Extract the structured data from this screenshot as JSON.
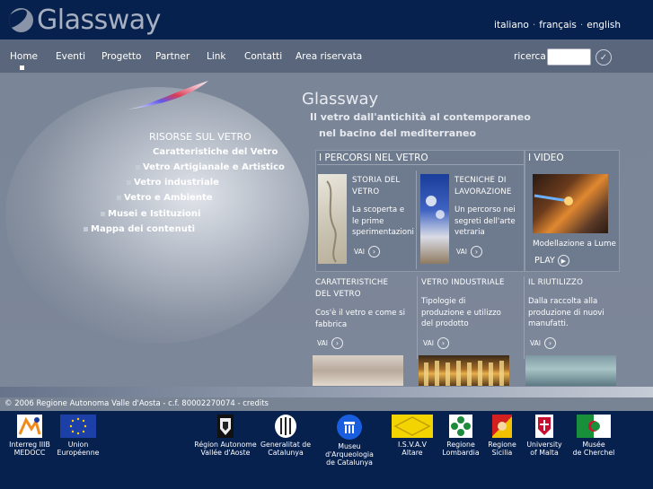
{
  "header": {
    "logo_text": "Glassway",
    "languages": [
      "italiano",
      "français",
      "english"
    ],
    "language_separator": "·"
  },
  "nav": {
    "items": [
      "Home",
      "Eventi",
      "Progetto",
      "Partner",
      "Link",
      "Contatti",
      "Area riservata"
    ],
    "search_label": "ricerca",
    "search_value": ""
  },
  "resources": {
    "title": "RISORSE SUL VETRO",
    "items": [
      "Caratteristiche del Vetro",
      "Vetro Artigianale e Artistico",
      "Vetro industriale",
      "Vetro e Ambiente",
      "Musei e Istituzioni",
      "Mappa dei contenuti"
    ]
  },
  "intro": {
    "title": "Glassway",
    "tagline_line1": "Il vetro dall'antichità al contemporaneo",
    "tagline_line2": "nel bacino del mediterraneo"
  },
  "percorsi": {
    "title": "I PERCORSI NEL VETRO",
    "cards": [
      {
        "title1": "STORIA DEL",
        "title2": "VETRO",
        "text": [
          "La scoperta e",
          "le prime",
          "sperimentazioni"
        ],
        "link": "VAI"
      },
      {
        "title1": "TECNICHE DI",
        "title2": "LAVORAZIONE",
        "text": [
          "Un percorso nei",
          "segreti dell'arte",
          "vetraria"
        ],
        "link": "VAI"
      }
    ]
  },
  "video": {
    "title": "I VIDEO",
    "caption": "Modellazione a Lume",
    "play_label": "PLAY"
  },
  "bottom_cards": [
    {
      "title1": "CARATTERISTICHE",
      "title2": "DEL VETRO",
      "text": [
        "Cos'è il vetro e come si",
        "fabbrica"
      ],
      "link": "VAI"
    },
    {
      "title1": "VETRO INDUSTRIALE",
      "title2": "",
      "text": [
        "Tipologie di",
        "produzione e utilizzo",
        "del prodotto"
      ],
      "link": "VAI"
    },
    {
      "title1": "IL RIUTILIZZO",
      "title2": "",
      "text": [
        "Dalla raccolta alla",
        "produzione di nuovi",
        "manufatti."
      ],
      "link": "VAI"
    }
  ],
  "footer": {
    "copyright": "© 2006 Regione Autonoma Valle d'Aosta - c.f. 80002270074 - credits",
    "partners": [
      {
        "line1": "Interreg IIIB",
        "line2": "MEDOCC"
      },
      {
        "line1": "Union",
        "line2": "Européenne"
      },
      {
        "line1": "Région Autonome",
        "line2": "Vallée d'Aoste"
      },
      {
        "line1": "Generalitat de",
        "line2": "Catalunya"
      },
      {
        "line1": "Museu d'Arqueologia",
        "line2": "de Catalunya"
      },
      {
        "line1": "I.S.V.A.V",
        "line2": "Altare"
      },
      {
        "line1": "Regione",
        "line2": "Lombardia"
      },
      {
        "line1": "Regione",
        "line2": "Sicilia"
      },
      {
        "line1": "University",
        "line2": "of Malta"
      },
      {
        "line1": "Musée",
        "line2": "de Cherchel"
      }
    ]
  },
  "colors": {
    "header_bg": "#07214e",
    "nav_bg": "#59667b",
    "main_bg": "#7a8597",
    "box_bg": "#6e7a8d"
  }
}
